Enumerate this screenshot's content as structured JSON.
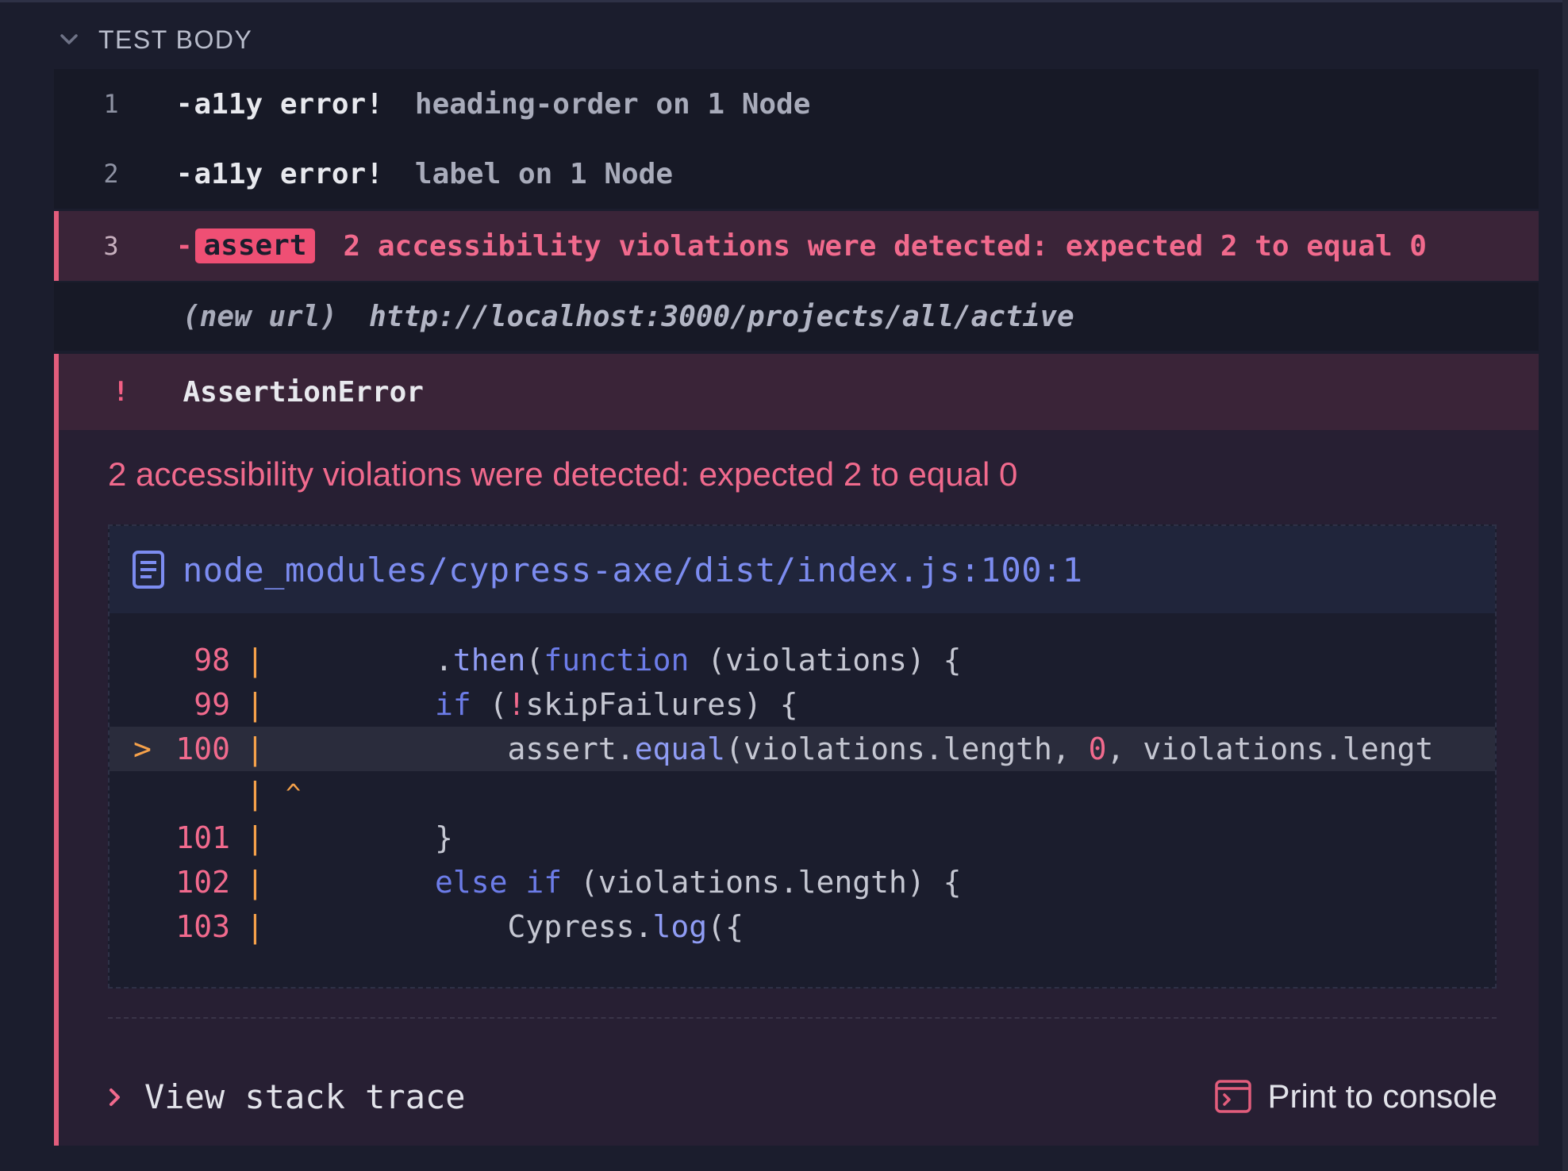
{
  "section": {
    "title": "TEST BODY"
  },
  "commands": [
    {
      "num": "1",
      "dash": "-",
      "name": "a11y error!",
      "message": "heading-order on 1 Node"
    },
    {
      "num": "2",
      "dash": "-",
      "name": "a11y error!",
      "message": "label on 1 Node"
    },
    {
      "num": "3",
      "dash": "-",
      "name": "assert",
      "message": "2 accessibility violations were detected: expected 2 to equal 0"
    }
  ],
  "url_row": {
    "label": "(new url)",
    "value": "http://localhost:3000/projects/all/active"
  },
  "error": {
    "bang": "!",
    "name": "AssertionError",
    "message": "2 accessibility violations were detected: expected 2 to equal 0",
    "file": "node_modules/cypress-axe/dist/index.js:100:1",
    "lines": [
      {
        "num": "98",
        "code": ".then(function (violations) {"
      },
      {
        "num": "99",
        "code": "if (!skipFailures) {"
      },
      {
        "num": "100",
        "code": "    assert.equal(violations.length, 0, violations.lengt",
        "highlight": true
      },
      {
        "num": "101",
        "code": "}"
      },
      {
        "num": "102",
        "code": "else if (violations.length) {"
      },
      {
        "num": "103",
        "code": "    Cypress.log({"
      }
    ],
    "pointer": ">",
    "gutter_bar": "|",
    "caret": "^"
  },
  "footer": {
    "stack_label": "View stack trace",
    "print_label": "Print to console"
  },
  "icons": {
    "collapse": "chevron-down-icon",
    "file": "file-icon",
    "expand": "chevron-right-icon",
    "console": "terminal-icon"
  },
  "colors": {
    "error": "#f16a8d",
    "accent": "#e25d7c",
    "link": "#7c8cf0",
    "warning": "#f5a14a"
  }
}
